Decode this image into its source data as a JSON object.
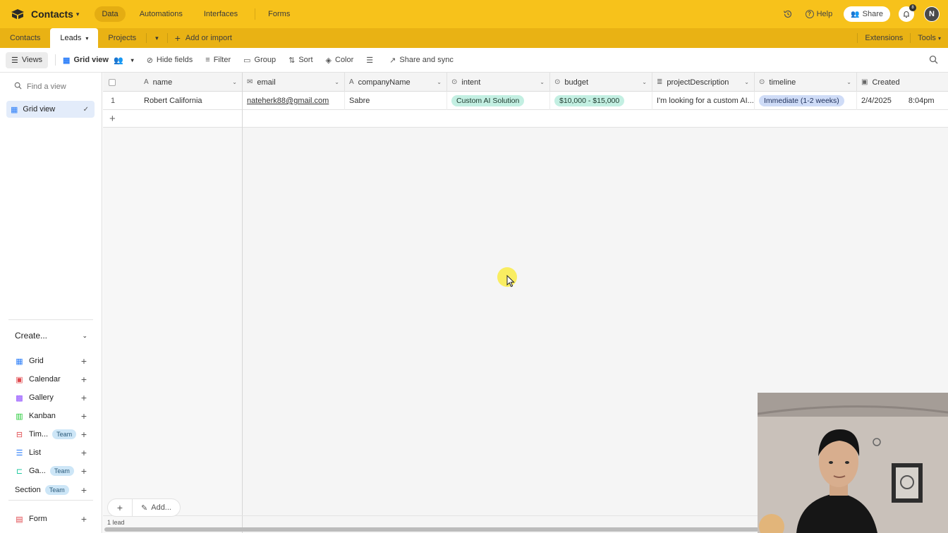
{
  "app": {
    "base_name": "Contacts"
  },
  "topnav": [
    "Data",
    "Automations",
    "Interfaces",
    "Forms"
  ],
  "topright": {
    "help": "Help",
    "share": "Share",
    "avatar": "N",
    "notif_count": "8"
  },
  "tabs": {
    "items": [
      "Contacts",
      "Leads",
      "Projects"
    ],
    "active": "Leads",
    "add_import": "Add or import",
    "extensions": "Extensions",
    "tools": "Tools"
  },
  "viewbar": {
    "views": "Views",
    "grid_view": "Grid view",
    "hide_fields": "Hide fields",
    "filter": "Filter",
    "group": "Group",
    "sort": "Sort",
    "color": "Color",
    "share_sync": "Share and sync"
  },
  "sidebar": {
    "find_placeholder": "Find a view",
    "views": [
      {
        "label": "Grid view"
      }
    ],
    "create_label": "Create...",
    "create_items": [
      {
        "label": "Grid",
        "icon": "grid-icon",
        "color": "#2d7ff9"
      },
      {
        "label": "Calendar",
        "icon": "calendar-icon",
        "color": "#e0484d"
      },
      {
        "label": "Gallery",
        "icon": "gallery-icon",
        "color": "#8b46ff"
      },
      {
        "label": "Kanban",
        "icon": "kanban-icon",
        "color": "#20c933"
      },
      {
        "label": "Tim...",
        "icon": "timeline-icon",
        "color": "#e0484d",
        "team": "Team"
      },
      {
        "label": "List",
        "icon": "list-icon",
        "color": "#2d7ff9"
      },
      {
        "label": "Ga...",
        "icon": "gantt-icon",
        "color": "#20c9a0",
        "team": "Team"
      },
      {
        "label": "Section",
        "team": "Team"
      }
    ],
    "form": {
      "label": "Form",
      "icon": "form-icon",
      "color": "#e0484d"
    }
  },
  "grid": {
    "columns": [
      "name",
      "email",
      "companyName",
      "intent",
      "budget",
      "projectDescription",
      "timeline",
      "Created"
    ],
    "rows": [
      {
        "num": "1",
        "name": "Robert California",
        "email": "nateherk88@gmail.com",
        "companyName": "Sabre",
        "intent": "Custom AI Solution",
        "budget": "$10,000 - $15,000",
        "projectDescription": "I'm looking for a custom AI...",
        "timeline": "Immediate (1-2 weeks)",
        "created_date": "2/4/2025",
        "created_time": "8:04pm"
      }
    ],
    "footer": {
      "add_label": "Add...",
      "count": "1 lead"
    }
  },
  "colors": {
    "topbar": "#f7c21b",
    "tabbar": "#e9b214",
    "chip_teal": "#c3efe2",
    "chip_blue": "#cfdcf7"
  }
}
